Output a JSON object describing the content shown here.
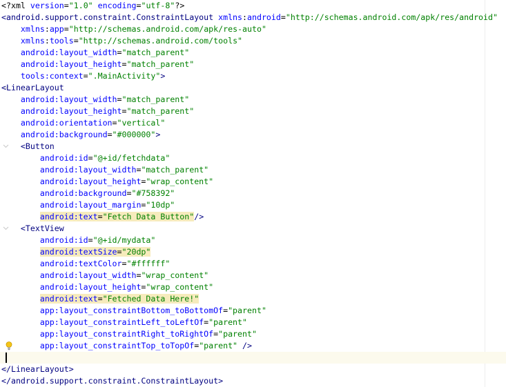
{
  "editor": {
    "lines": [
      {
        "segments": [
          {
            "t": "<?xml ",
            "c": "pun"
          },
          {
            "t": "version",
            "c": "attr"
          },
          {
            "t": "=",
            "c": "pun"
          },
          {
            "t": "\"1.0\"",
            "c": "val"
          },
          {
            "t": " ",
            "c": "pun"
          },
          {
            "t": "encoding",
            "c": "attr"
          },
          {
            "t": "=",
            "c": "pun"
          },
          {
            "t": "\"utf-8\"",
            "c": "val"
          },
          {
            "t": "?>",
            "c": "pun"
          }
        ]
      },
      {
        "segments": [
          {
            "t": "<android.support.constraint.ConstraintLayout ",
            "c": "tag"
          },
          {
            "t": "xmlns",
            "c": "xmlns"
          },
          {
            "t": ":",
            "c": "pun"
          },
          {
            "t": "android",
            "c": "attr"
          },
          {
            "t": "=",
            "c": "pun"
          },
          {
            "t": "\"http://schemas.android.com/apk/res/android\"",
            "c": "val"
          }
        ]
      },
      {
        "segments": [
          {
            "t": "    ",
            "c": "pun"
          },
          {
            "t": "xmlns",
            "c": "xmlns"
          },
          {
            "t": ":",
            "c": "pun"
          },
          {
            "t": "app",
            "c": "attr"
          },
          {
            "t": "=",
            "c": "pun"
          },
          {
            "t": "\"http://schemas.android.com/apk/res-auto\"",
            "c": "val"
          }
        ]
      },
      {
        "segments": [
          {
            "t": "    ",
            "c": "pun"
          },
          {
            "t": "xmlns",
            "c": "xmlns"
          },
          {
            "t": ":",
            "c": "pun"
          },
          {
            "t": "tools",
            "c": "attr"
          },
          {
            "t": "=",
            "c": "pun"
          },
          {
            "t": "\"http://schemas.android.com/tools\"",
            "c": "val"
          }
        ]
      },
      {
        "segments": [
          {
            "t": "    android:layout_width",
            "c": "attr"
          },
          {
            "t": "=",
            "c": "pun"
          },
          {
            "t": "\"match_parent\"",
            "c": "val"
          }
        ]
      },
      {
        "segments": [
          {
            "t": "    android:layout_height",
            "c": "attr"
          },
          {
            "t": "=",
            "c": "pun"
          },
          {
            "t": "\"match_parent\"",
            "c": "val"
          }
        ]
      },
      {
        "segments": [
          {
            "t": "    tools:context",
            "c": "attr"
          },
          {
            "t": "=",
            "c": "pun"
          },
          {
            "t": "\".MainActivity\"",
            "c": "val"
          },
          {
            "t": ">",
            "c": "tag"
          }
        ]
      },
      {
        "fold": true,
        "segments": [
          {
            "t": "<LinearLayout",
            "c": "tag"
          }
        ]
      },
      {
        "segments": [
          {
            "t": "    android:layout_width",
            "c": "attr"
          },
          {
            "t": "=",
            "c": "pun"
          },
          {
            "t": "\"match_parent\"",
            "c": "val"
          }
        ]
      },
      {
        "segments": [
          {
            "t": "    android:layout_height",
            "c": "attr"
          },
          {
            "t": "=",
            "c": "pun"
          },
          {
            "t": "\"match_parent\"",
            "c": "val"
          }
        ]
      },
      {
        "segments": [
          {
            "t": "    android:orientation",
            "c": "attr"
          },
          {
            "t": "=",
            "c": "pun"
          },
          {
            "t": "\"vertical\"",
            "c": "val"
          }
        ]
      },
      {
        "segments": [
          {
            "t": "    android:background",
            "c": "attr"
          },
          {
            "t": "=",
            "c": "pun"
          },
          {
            "t": "\"#000000\"",
            "c": "val"
          },
          {
            "t": ">",
            "c": "tag"
          }
        ]
      },
      {
        "fold": true,
        "segments": [
          {
            "t": "    <Button",
            "c": "tag"
          }
        ]
      },
      {
        "segments": [
          {
            "t": "        android:id",
            "c": "attr"
          },
          {
            "t": "=",
            "c": "pun"
          },
          {
            "t": "\"@+id/fetchdata\"",
            "c": "val"
          }
        ]
      },
      {
        "segments": [
          {
            "t": "        android:layout_width",
            "c": "attr"
          },
          {
            "t": "=",
            "c": "pun"
          },
          {
            "t": "\"match_parent\"",
            "c": "val"
          }
        ]
      },
      {
        "segments": [
          {
            "t": "        android:layout_height",
            "c": "attr"
          },
          {
            "t": "=",
            "c": "pun"
          },
          {
            "t": "\"wrap_content\"",
            "c": "val"
          }
        ]
      },
      {
        "segments": [
          {
            "t": "        android:background",
            "c": "attr"
          },
          {
            "t": "=",
            "c": "pun"
          },
          {
            "t": "\"#758392\"",
            "c": "val"
          }
        ]
      },
      {
        "segments": [
          {
            "t": "        android:layout_margin",
            "c": "attr"
          },
          {
            "t": "=",
            "c": "pun"
          },
          {
            "t": "\"10dp\"",
            "c": "val"
          }
        ]
      },
      {
        "segments": [
          {
            "t": "        ",
            "c": "pun"
          },
          {
            "t": "android:text",
            "c": "attr",
            "hl": true
          },
          {
            "t": "=",
            "c": "pun",
            "hl": true
          },
          {
            "t": "\"Fetch Data Button\"",
            "c": "val",
            "hl": true
          },
          {
            "t": "/>",
            "c": "tag"
          }
        ]
      },
      {
        "fold": true,
        "segments": [
          {
            "t": "    <TextView",
            "c": "tag"
          }
        ]
      },
      {
        "segments": [
          {
            "t": "        android:id",
            "c": "attr"
          },
          {
            "t": "=",
            "c": "pun"
          },
          {
            "t": "\"@+id/mydata\"",
            "c": "val"
          }
        ]
      },
      {
        "segments": [
          {
            "t": "        ",
            "c": "pun"
          },
          {
            "t": "android:textSize",
            "c": "attr",
            "hl": true
          },
          {
            "t": "=",
            "c": "pun",
            "hl": true
          },
          {
            "t": "\"20dp\"",
            "c": "val",
            "hl": true
          }
        ]
      },
      {
        "segments": [
          {
            "t": "        android:textColor",
            "c": "attr"
          },
          {
            "t": "=",
            "c": "pun"
          },
          {
            "t": "\"#ffffff\"",
            "c": "val"
          }
        ]
      },
      {
        "segments": [
          {
            "t": "        android:layout_width",
            "c": "attr"
          },
          {
            "t": "=",
            "c": "pun"
          },
          {
            "t": "\"wrap_content\"",
            "c": "val"
          }
        ]
      },
      {
        "segments": [
          {
            "t": "        android:layout_height",
            "c": "attr"
          },
          {
            "t": "=",
            "c": "pun"
          },
          {
            "t": "\"wrap_content\"",
            "c": "val"
          }
        ]
      },
      {
        "segments": [
          {
            "t": "        ",
            "c": "pun"
          },
          {
            "t": "android:text",
            "c": "attr",
            "hl": true
          },
          {
            "t": "=",
            "c": "pun",
            "hl": true
          },
          {
            "t": "\"Fetched Data Here!\"",
            "c": "val",
            "hl": true
          }
        ]
      },
      {
        "segments": [
          {
            "t": "        app:layout_constraintBottom_toBottomOf",
            "c": "attr"
          },
          {
            "t": "=",
            "c": "pun"
          },
          {
            "t": "\"parent\"",
            "c": "val"
          }
        ]
      },
      {
        "segments": [
          {
            "t": "        app:layout_constraintLeft_toLeftOf",
            "c": "attr"
          },
          {
            "t": "=",
            "c": "pun"
          },
          {
            "t": "\"parent\"",
            "c": "val"
          }
        ]
      },
      {
        "segments": [
          {
            "t": "        app:layout_constraintRight_toRightOf",
            "c": "attr"
          },
          {
            "t": "=",
            "c": "pun"
          },
          {
            "t": "\"parent\"",
            "c": "val"
          }
        ]
      },
      {
        "bulb": true,
        "segments": [
          {
            "t": "        app:layout_constraintTop_toTopOf",
            "c": "attr"
          },
          {
            "t": "=",
            "c": "pun"
          },
          {
            "t": "\"parent\"",
            "c": "val"
          },
          {
            "t": " />",
            "c": "tag"
          }
        ]
      },
      {
        "current": true,
        "caret": true,
        "segments": [
          {
            "t": "",
            "c": "pun"
          }
        ]
      },
      {
        "fold": true,
        "segments": [
          {
            "t": "</LinearLayout>",
            "c": "tag"
          }
        ]
      },
      {
        "segments": [
          {
            "t": "</android.support.constraint.ConstraintLayout>",
            "c": "tag"
          }
        ]
      }
    ]
  },
  "colors": {
    "tag": "#000080",
    "attribute": "#0000ff",
    "value": "#008000",
    "highlight": "#f6ebbc",
    "current_line": "#fcfaed"
  },
  "icons": {
    "bulb": "lightbulb-icon",
    "fold": "fold-marker-icon"
  }
}
